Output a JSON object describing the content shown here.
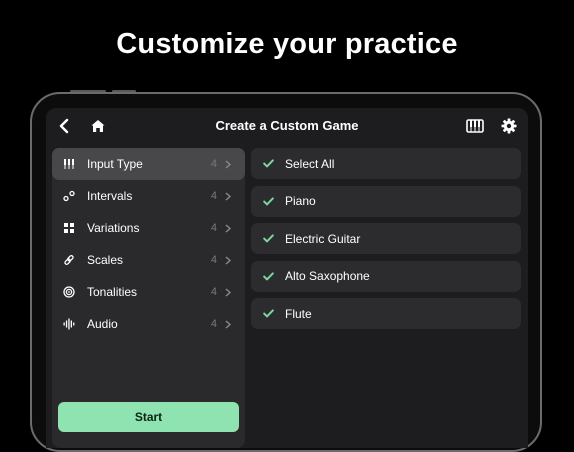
{
  "headline": "Customize your practice",
  "header": {
    "title": "Create a Custom Game",
    "back_icon": "chevron-left-icon",
    "home_icon": "home-icon",
    "piano_icon": "piano-keys-icon",
    "settings_icon": "gear-icon"
  },
  "sidebar": {
    "items": [
      {
        "label": "Input Type",
        "count": "4",
        "icon": "tuning-fork-icon",
        "active": true
      },
      {
        "label": "Intervals",
        "count": "4",
        "icon": "intervals-icon",
        "active": false
      },
      {
        "label": "Variations",
        "count": "4",
        "icon": "grid-icon",
        "active": false
      },
      {
        "label": "Scales",
        "count": "4",
        "icon": "link-icon",
        "active": false
      },
      {
        "label": "Tonalities",
        "count": "4",
        "icon": "target-icon",
        "active": false
      },
      {
        "label": "Audio",
        "count": "4",
        "icon": "waveform-icon",
        "active": false
      }
    ],
    "start_label": "Start"
  },
  "options": [
    {
      "label": "Select All",
      "checked": true
    },
    {
      "label": "Piano",
      "checked": true
    },
    {
      "label": "Electric Guitar",
      "checked": true
    },
    {
      "label": "Alto Saxophone",
      "checked": true
    },
    {
      "label": "Flute",
      "checked": true
    }
  ],
  "colors": {
    "accent_green": "#8fe3b0",
    "check_green": "#7fd69d",
    "panel": "#2a2a2c",
    "active_row": "#48484b"
  }
}
